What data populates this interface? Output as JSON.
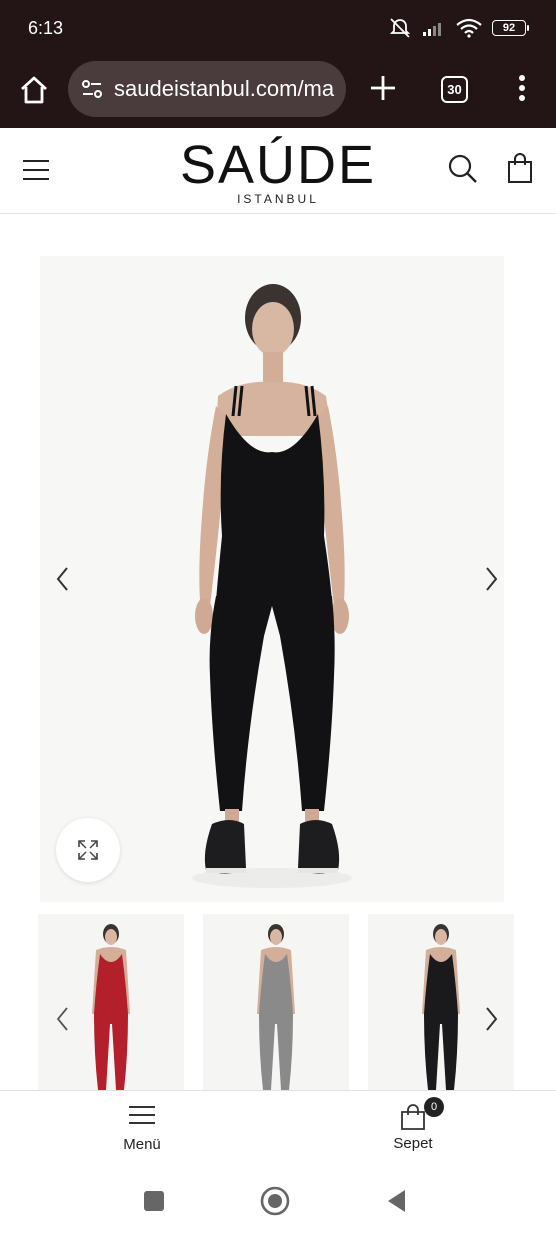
{
  "status_bar": {
    "time": "6:13",
    "battery": "92",
    "icons": [
      "do-not-disturb-icon",
      "signal-icon",
      "wifi-icon",
      "battery-icon"
    ]
  },
  "browser": {
    "url": "saudeistanbul.com/ma",
    "tab_count": "30",
    "icons": [
      "home-icon",
      "site-settings-icon",
      "new-tab-plus-icon",
      "tab-switcher-icon",
      "more-vert-icon"
    ]
  },
  "site_header": {
    "brand": "SAÚDE",
    "brand_sub": "ISTANBUL",
    "icons": [
      "hamburger-menu-icon",
      "search-icon",
      "shopping-bag-icon"
    ]
  },
  "gallery": {
    "icons": [
      "chevron-left-icon",
      "chevron-right-icon",
      "expand-icon"
    ],
    "thumbnails": [
      {
        "color_name": "red",
        "color": "#b3202c"
      },
      {
        "color_name": "grey",
        "color": "#8a8a8a"
      },
      {
        "color_name": "black",
        "color": "#1a1a1c"
      }
    ]
  },
  "bottom_nav": {
    "menu_label": "Menü",
    "cart_label": "Sepet",
    "cart_count": "0"
  },
  "colors": {
    "browser_chrome": "#231416",
    "url_box": "#4a3b3c",
    "product": "#121214"
  }
}
